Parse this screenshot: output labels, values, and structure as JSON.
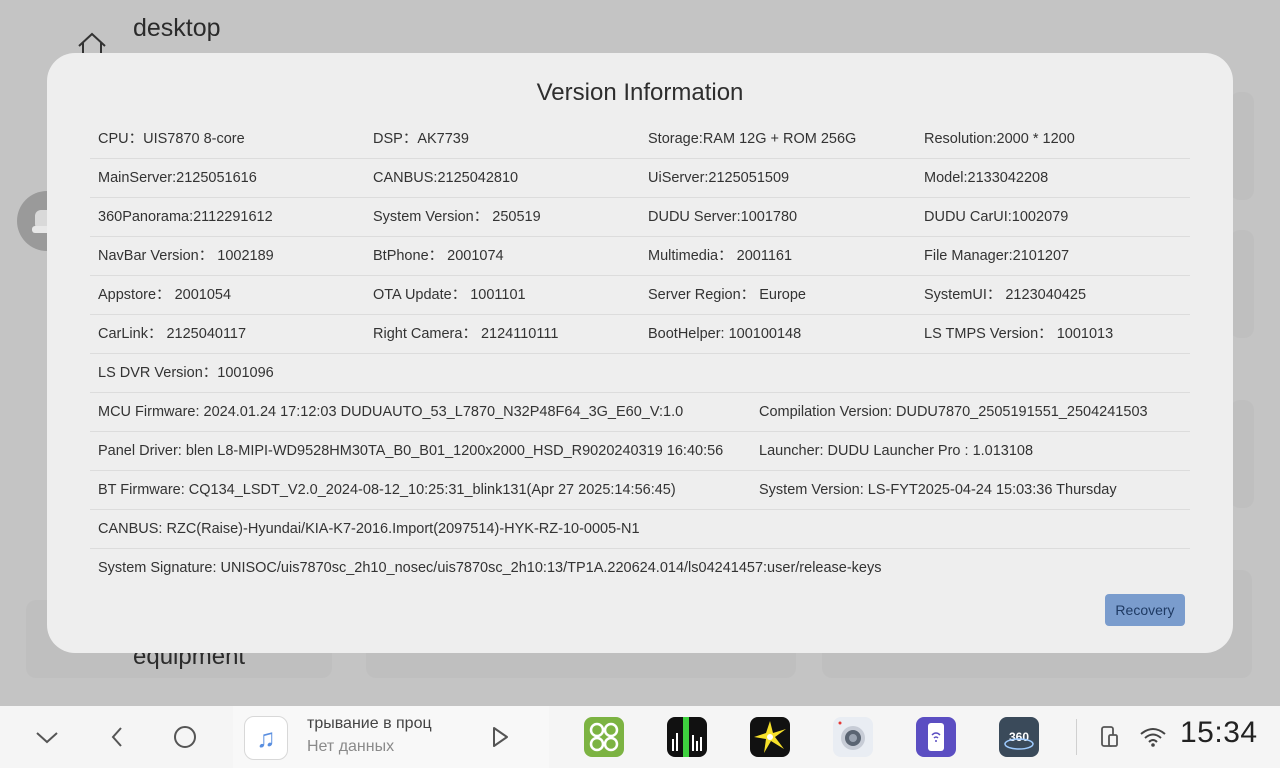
{
  "background": {
    "title": "desktop",
    "bottom_label": "equipment"
  },
  "dialog": {
    "title": "Version Information",
    "rows4": [
      [
        "CPU：UIS7870 8-core",
        "DSP：AK7739",
        "Storage:RAM 12G + ROM 256G",
        "Resolution:2000 * 1200"
      ],
      [
        "MainServer:2125051616",
        "CANBUS:2125042810",
        "UiServer:2125051509",
        "Model:2133042208"
      ],
      [
        "360Panorama:2112291612",
        "System Version： 250519",
        "DUDU Server:1001780",
        "DUDU CarUI:1002079"
      ],
      [
        "NavBar Version： 1002189",
        "BtPhone： 2001074",
        "Multimedia： 2001161",
        "File Manager:2101207"
      ],
      [
        "Appstore： 2001054",
        "OTA Update： 1001101",
        "Server Region： Europe",
        "SystemUI： 2123040425"
      ],
      [
        "CarLink： 2125040117",
        "Right Camera： 2124110111",
        "BootHelper: 100100148",
        "LS TMPS Version： 1001013"
      ],
      [
        "LS DVR Version：1001096",
        "",
        "",
        ""
      ]
    ],
    "rows2": [
      [
        "MCU Firmware:  2024.01.24 17:12:03 DUDUAUTO_53_L7870_N32P48F64_3G_E60_V:1.0",
        "Compilation Version:  DUDU7870_2505191551_2504241503"
      ],
      [
        "Panel Driver:  blen L8-MIPI-WD9528HM30TA_B0_B01_1200x2000_HSD_R9020240319 16:40:56",
        "Launcher:  DUDU Launcher Pro : 1.013108"
      ],
      [
        "BT Firmware:  CQ134_LSDT_V2.0_2024-08-12_10:25:31_blink131(Apr 27 2025:14:56:45)",
        "System Version:  LS-FYT2025-04-24 15:03:36 Thursday"
      ]
    ],
    "rows1": [
      "CANBUS:  RZC(Raise)-Hyundai/KIA-K7-2016.Import(2097514)-HYK-RZ-10-0005-N1",
      "System Signature:  UNISOC/uis7870sc_2h10_nosec/uis7870sc_2h10:13/TP1A.220624.014/ls04241457:user/release-keys"
    ],
    "recovery_label": "Recovery"
  },
  "taskbar": {
    "media_title": "трывание в проц",
    "media_subtitle": "Нет данных",
    "time": "15:34",
    "apps": [
      "multi-circle-app-icon",
      "audio-visualizer-app-icon",
      "sparkle-app-icon",
      "camera-lens-app-icon",
      "phone-link-app-icon",
      "360-camera-app-icon"
    ],
    "accent": "#7a9ccd"
  }
}
